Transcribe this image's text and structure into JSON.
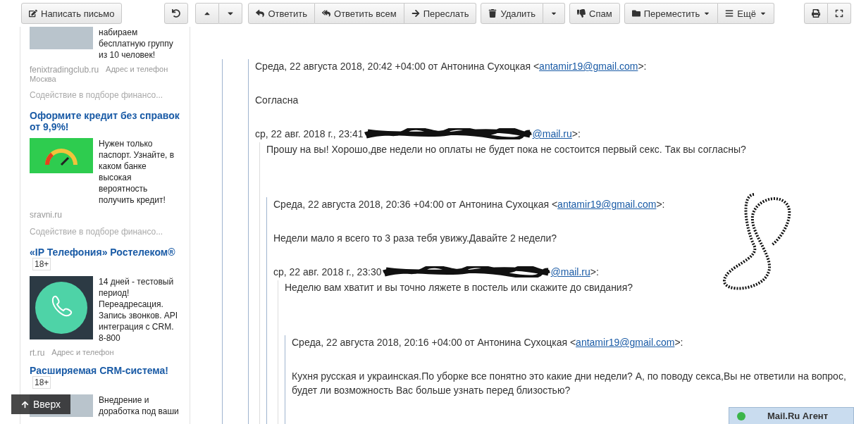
{
  "toolbar": {
    "groups": [
      {
        "buttons": [
          {
            "label": "Написать письмо",
            "menu": false
          }
        ]
      },
      {
        "buttons": [
          {
            "menu": false
          }
        ]
      },
      {
        "buttons": [
          {
            "menu": false
          },
          {
            "menu": false
          }
        ]
      },
      {
        "buttons": [
          {
            "label": "Ответить",
            "menu": false
          },
          {
            "label": "Ответить всем",
            "menu": false
          },
          {
            "label": "Переслать",
            "menu": false
          }
        ]
      },
      {
        "buttons": [
          {
            "label": "Удалить",
            "menu": false
          },
          {
            "menu": true
          }
        ]
      },
      {
        "buttons": [
          {
            "label": "Спам",
            "menu": false
          }
        ]
      },
      {
        "buttons": [
          {
            "label": "Переместить",
            "menu": true
          },
          {
            "label": "Ещё",
            "menu": true
          }
        ]
      },
      {
        "buttons": [
          {
            "menu": false
          },
          {
            "menu": false
          }
        ]
      }
    ]
  },
  "sidebar": {
    "items": [
      {
        "kind": "ad",
        "text": "набираем бесплатную группу из 10 человек!",
        "domain": "fenixtradingclub.ru",
        "extra": "Адрес и телефон",
        "city": "Москва"
      },
      {
        "kind": "note",
        "text": "Содействие в подборе финансо..."
      },
      {
        "kind": "ad",
        "title": "Оформите кредит без справок от 9,9%!",
        "text": "Нужен только паспорт. Узнайте, в каком банке высокая вероятность получить кредит!",
        "domain": "sravni.ru"
      },
      {
        "kind": "note",
        "text": "Содействие в подборе финансо..."
      },
      {
        "kind": "ad",
        "title": "«IP Телефония» Ростелеком®",
        "age_badge": "18+",
        "text": "14 дней - тестовый период! Переадресация. Запись звонков. API интеграция с CRM. 8-800",
        "domain": "rt.ru",
        "extra": "Адрес и телефон"
      },
      {
        "kind": "ad",
        "title": "Расширяемая CRM-система!",
        "age_badge": "18+",
        "text": "Внедрение и доработка под ваши"
      }
    ]
  },
  "scroll_top": {
    "label": "Вверх"
  },
  "message": {
    "header": {
      "prefix": "Среда, 22 августа 2018, 20:42 +04:00 от Антонина Сухоцкая <",
      "email": "antamir19@gmail.com",
      "suffix": ">:"
    },
    "body": "Согласна",
    "reply": {
      "prefix": "ср, 22 авг. 2018 г., 23:41",
      "link": "@mail.ru",
      "suffix": ">:"
    },
    "quote": {
      "text": "Прошу на вы! Хорошо,две недели но оплаты не будет пока не состоится первый секс. Так вы согласны?",
      "message": {
        "header": {
          "prefix": "Среда, 22 августа 2018, 20:36 +04:00 от Антонина Сухоцкая <",
          "email": "antamir19@gmail.com",
          "suffix": ">:"
        },
        "body": "Недели мало я всего то 3 раза тебя увижу.Давайте 2 недели?",
        "reply": {
          "prefix": "ср, 22 авг. 2018 г., 23:30",
          "link": "@mail.ru",
          "suffix": ">:"
        },
        "quote": {
          "text": "Неделю вам хватит и вы точно ляжете в постель или скажите до свидания?",
          "message": {
            "header": {
              "prefix": "Среда, 22 августа 2018, 20:16 +04:00 от Антонина Сухоцкая <",
              "email": "antamir19@gmail.com",
              "suffix": ">:"
            },
            "body": "Кухня русская и украинская.По уборке все понятно это какие дни недели? А, по поводу секса,Вы не ответили на вопрос, будет ли возможность Вас больше узнать перед близостью?"
          }
        }
      }
    }
  },
  "agent": {
    "label": "Mail.Ru Агент"
  }
}
